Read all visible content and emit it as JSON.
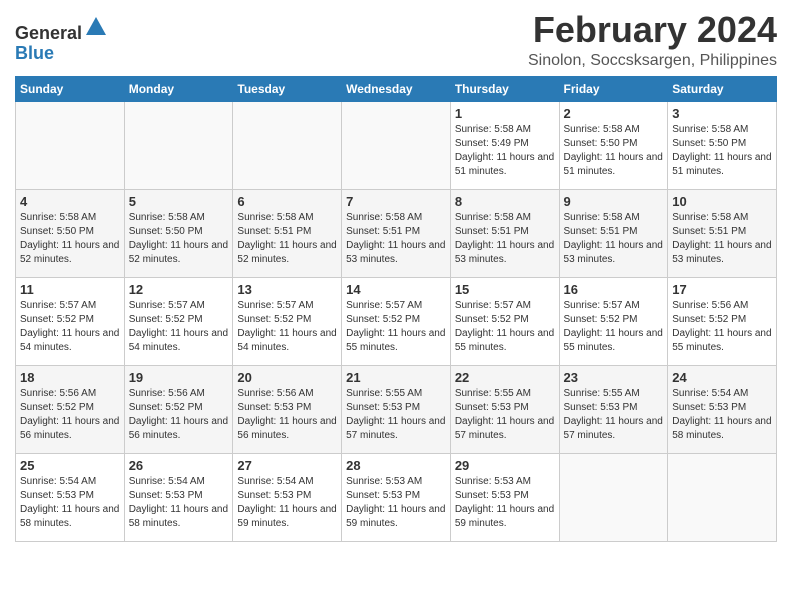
{
  "logo": {
    "general": "General",
    "blue": "Blue"
  },
  "title": "February 2024",
  "location": "Sinolon, Soccsksargen, Philippines",
  "days_of_week": [
    "Sunday",
    "Monday",
    "Tuesday",
    "Wednesday",
    "Thursday",
    "Friday",
    "Saturday"
  ],
  "weeks": [
    [
      {
        "day": "",
        "sunrise": "",
        "sunset": "",
        "daylight": ""
      },
      {
        "day": "",
        "sunrise": "",
        "sunset": "",
        "daylight": ""
      },
      {
        "day": "",
        "sunrise": "",
        "sunset": "",
        "daylight": ""
      },
      {
        "day": "",
        "sunrise": "",
        "sunset": "",
        "daylight": ""
      },
      {
        "day": "1",
        "sunrise": "Sunrise: 5:58 AM",
        "sunset": "Sunset: 5:49 PM",
        "daylight": "Daylight: 11 hours and 51 minutes."
      },
      {
        "day": "2",
        "sunrise": "Sunrise: 5:58 AM",
        "sunset": "Sunset: 5:50 PM",
        "daylight": "Daylight: 11 hours and 51 minutes."
      },
      {
        "day": "3",
        "sunrise": "Sunrise: 5:58 AM",
        "sunset": "Sunset: 5:50 PM",
        "daylight": "Daylight: 11 hours and 51 minutes."
      }
    ],
    [
      {
        "day": "4",
        "sunrise": "Sunrise: 5:58 AM",
        "sunset": "Sunset: 5:50 PM",
        "daylight": "Daylight: 11 hours and 52 minutes."
      },
      {
        "day": "5",
        "sunrise": "Sunrise: 5:58 AM",
        "sunset": "Sunset: 5:50 PM",
        "daylight": "Daylight: 11 hours and 52 minutes."
      },
      {
        "day": "6",
        "sunrise": "Sunrise: 5:58 AM",
        "sunset": "Sunset: 5:51 PM",
        "daylight": "Daylight: 11 hours and 52 minutes."
      },
      {
        "day": "7",
        "sunrise": "Sunrise: 5:58 AM",
        "sunset": "Sunset: 5:51 PM",
        "daylight": "Daylight: 11 hours and 53 minutes."
      },
      {
        "day": "8",
        "sunrise": "Sunrise: 5:58 AM",
        "sunset": "Sunset: 5:51 PM",
        "daylight": "Daylight: 11 hours and 53 minutes."
      },
      {
        "day": "9",
        "sunrise": "Sunrise: 5:58 AM",
        "sunset": "Sunset: 5:51 PM",
        "daylight": "Daylight: 11 hours and 53 minutes."
      },
      {
        "day": "10",
        "sunrise": "Sunrise: 5:58 AM",
        "sunset": "Sunset: 5:51 PM",
        "daylight": "Daylight: 11 hours and 53 minutes."
      }
    ],
    [
      {
        "day": "11",
        "sunrise": "Sunrise: 5:57 AM",
        "sunset": "Sunset: 5:52 PM",
        "daylight": "Daylight: 11 hours and 54 minutes."
      },
      {
        "day": "12",
        "sunrise": "Sunrise: 5:57 AM",
        "sunset": "Sunset: 5:52 PM",
        "daylight": "Daylight: 11 hours and 54 minutes."
      },
      {
        "day": "13",
        "sunrise": "Sunrise: 5:57 AM",
        "sunset": "Sunset: 5:52 PM",
        "daylight": "Daylight: 11 hours and 54 minutes."
      },
      {
        "day": "14",
        "sunrise": "Sunrise: 5:57 AM",
        "sunset": "Sunset: 5:52 PM",
        "daylight": "Daylight: 11 hours and 55 minutes."
      },
      {
        "day": "15",
        "sunrise": "Sunrise: 5:57 AM",
        "sunset": "Sunset: 5:52 PM",
        "daylight": "Daylight: 11 hours and 55 minutes."
      },
      {
        "day": "16",
        "sunrise": "Sunrise: 5:57 AM",
        "sunset": "Sunset: 5:52 PM",
        "daylight": "Daylight: 11 hours and 55 minutes."
      },
      {
        "day": "17",
        "sunrise": "Sunrise: 5:56 AM",
        "sunset": "Sunset: 5:52 PM",
        "daylight": "Daylight: 11 hours and 55 minutes."
      }
    ],
    [
      {
        "day": "18",
        "sunrise": "Sunrise: 5:56 AM",
        "sunset": "Sunset: 5:52 PM",
        "daylight": "Daylight: 11 hours and 56 minutes."
      },
      {
        "day": "19",
        "sunrise": "Sunrise: 5:56 AM",
        "sunset": "Sunset: 5:52 PM",
        "daylight": "Daylight: 11 hours and 56 minutes."
      },
      {
        "day": "20",
        "sunrise": "Sunrise: 5:56 AM",
        "sunset": "Sunset: 5:53 PM",
        "daylight": "Daylight: 11 hours and 56 minutes."
      },
      {
        "day": "21",
        "sunrise": "Sunrise: 5:55 AM",
        "sunset": "Sunset: 5:53 PM",
        "daylight": "Daylight: 11 hours and 57 minutes."
      },
      {
        "day": "22",
        "sunrise": "Sunrise: 5:55 AM",
        "sunset": "Sunset: 5:53 PM",
        "daylight": "Daylight: 11 hours and 57 minutes."
      },
      {
        "day": "23",
        "sunrise": "Sunrise: 5:55 AM",
        "sunset": "Sunset: 5:53 PM",
        "daylight": "Daylight: 11 hours and 57 minutes."
      },
      {
        "day": "24",
        "sunrise": "Sunrise: 5:54 AM",
        "sunset": "Sunset: 5:53 PM",
        "daylight": "Daylight: 11 hours and 58 minutes."
      }
    ],
    [
      {
        "day": "25",
        "sunrise": "Sunrise: 5:54 AM",
        "sunset": "Sunset: 5:53 PM",
        "daylight": "Daylight: 11 hours and 58 minutes."
      },
      {
        "day": "26",
        "sunrise": "Sunrise: 5:54 AM",
        "sunset": "Sunset: 5:53 PM",
        "daylight": "Daylight: 11 hours and 58 minutes."
      },
      {
        "day": "27",
        "sunrise": "Sunrise: 5:54 AM",
        "sunset": "Sunset: 5:53 PM",
        "daylight": "Daylight: 11 hours and 59 minutes."
      },
      {
        "day": "28",
        "sunrise": "Sunrise: 5:53 AM",
        "sunset": "Sunset: 5:53 PM",
        "daylight": "Daylight: 11 hours and 59 minutes."
      },
      {
        "day": "29",
        "sunrise": "Sunrise: 5:53 AM",
        "sunset": "Sunset: 5:53 PM",
        "daylight": "Daylight: 11 hours and 59 minutes."
      },
      {
        "day": "",
        "sunrise": "",
        "sunset": "",
        "daylight": ""
      },
      {
        "day": "",
        "sunrise": "",
        "sunset": "",
        "daylight": ""
      }
    ]
  ]
}
